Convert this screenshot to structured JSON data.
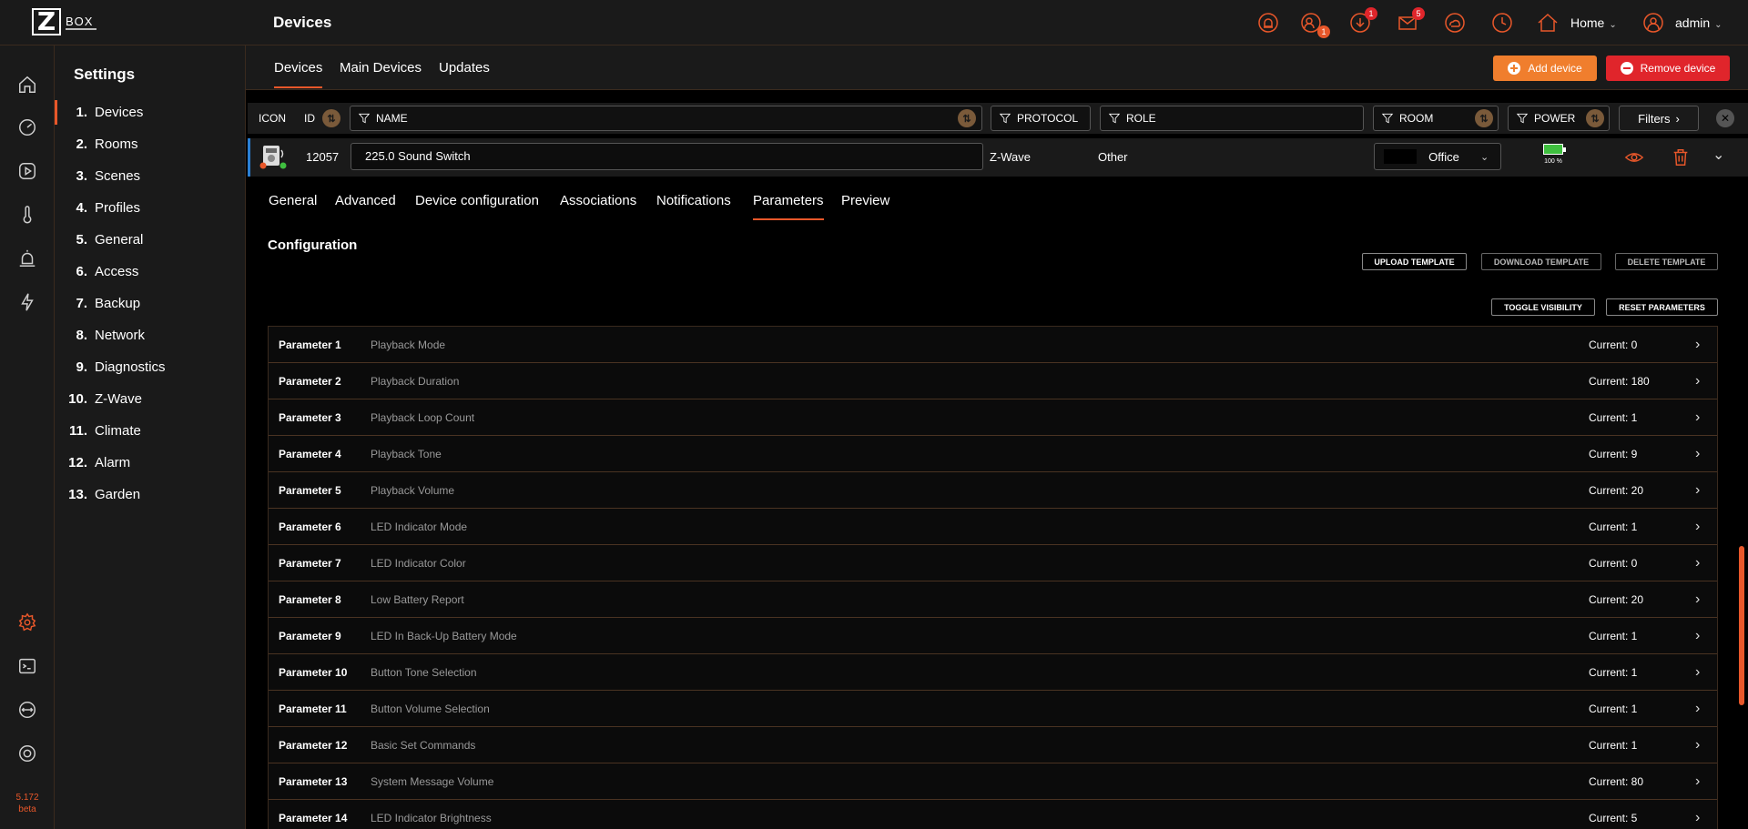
{
  "logo": {
    "letter": "Z",
    "text": "BOX"
  },
  "version": {
    "number": "5.172",
    "label": "beta"
  },
  "header": {
    "title": "Devices",
    "badges": {
      "users": "1",
      "downloads": "1",
      "messages": "5"
    },
    "home": "Home",
    "user": "admin"
  },
  "settings": {
    "title": "Settings",
    "items": [
      {
        "num": "1.",
        "label": "Devices"
      },
      {
        "num": "2.",
        "label": "Rooms"
      },
      {
        "num": "3.",
        "label": "Scenes"
      },
      {
        "num": "4.",
        "label": "Profiles"
      },
      {
        "num": "5.",
        "label": "General"
      },
      {
        "num": "6.",
        "label": "Access"
      },
      {
        "num": "7.",
        "label": "Backup"
      },
      {
        "num": "8.",
        "label": "Network"
      },
      {
        "num": "9.",
        "label": "Diagnostics"
      },
      {
        "num": "10.",
        "label": "Z-Wave"
      },
      {
        "num": "11.",
        "label": "Climate"
      },
      {
        "num": "12.",
        "label": "Alarm"
      },
      {
        "num": "13.",
        "label": "Garden"
      }
    ]
  },
  "subtabs": {
    "devices": "Devices",
    "main_devices": "Main Devices",
    "updates": "Updates"
  },
  "actions": {
    "add": "Add device",
    "remove": "Remove device"
  },
  "filters": {
    "icon": "ICON",
    "id": "ID",
    "name": "NAME",
    "protocol": "PROTOCOL",
    "role": "ROLE",
    "room": "ROOM",
    "power": "POWER",
    "filters_btn": "Filters"
  },
  "device": {
    "id": "12057",
    "name": "225.0 Sound Switch",
    "protocol": "Z-Wave",
    "role": "Other",
    "room": "Office",
    "power": "100 %"
  },
  "device_tabs": {
    "general": "General",
    "advanced": "Advanced",
    "config": "Device configuration",
    "associations": "Associations",
    "notifications": "Notifications",
    "parameters": "Parameters",
    "preview": "Preview"
  },
  "config": {
    "title": "Configuration",
    "upload": "UPLOAD TEMPLATE",
    "download": "DOWNLOAD TEMPLATE",
    "delete": "DELETE TEMPLATE",
    "toggle": "TOGGLE VISIBILITY",
    "reset": "RESET PARAMETERS"
  },
  "parameters": [
    {
      "num": "Parameter 1",
      "name": "Playback Mode",
      "current": "Current: 0"
    },
    {
      "num": "Parameter 2",
      "name": "Playback Duration",
      "current": "Current: 180"
    },
    {
      "num": "Parameter 3",
      "name": "Playback Loop Count",
      "current": "Current: 1"
    },
    {
      "num": "Parameter 4",
      "name": "Playback Tone",
      "current": "Current: 9"
    },
    {
      "num": "Parameter 5",
      "name": "Playback Volume",
      "current": "Current: 20"
    },
    {
      "num": "Parameter 6",
      "name": "LED Indicator Mode",
      "current": "Current: 1"
    },
    {
      "num": "Parameter 7",
      "name": "LED Indicator Color",
      "current": "Current: 0"
    },
    {
      "num": "Parameter 8",
      "name": "Low Battery Report",
      "current": "Current: 20"
    },
    {
      "num": "Parameter 9",
      "name": "LED In Back-Up Battery Mode",
      "current": "Current: 1"
    },
    {
      "num": "Parameter 10",
      "name": "Button Tone Selection",
      "current": "Current: 1"
    },
    {
      "num": "Parameter 11",
      "name": "Button Volume Selection",
      "current": "Current: 1"
    },
    {
      "num": "Parameter 12",
      "name": "Basic Set Commands",
      "current": "Current: 1"
    },
    {
      "num": "Parameter 13",
      "name": "System Message Volume",
      "current": "Current: 80"
    },
    {
      "num": "Parameter 14",
      "name": "LED Indicator Brightness",
      "current": "Current: 5"
    }
  ],
  "colors": {
    "accent": "#e8572a",
    "add": "#f07e2d",
    "remove": "#e0252b",
    "panel": "#1a1a1a"
  }
}
